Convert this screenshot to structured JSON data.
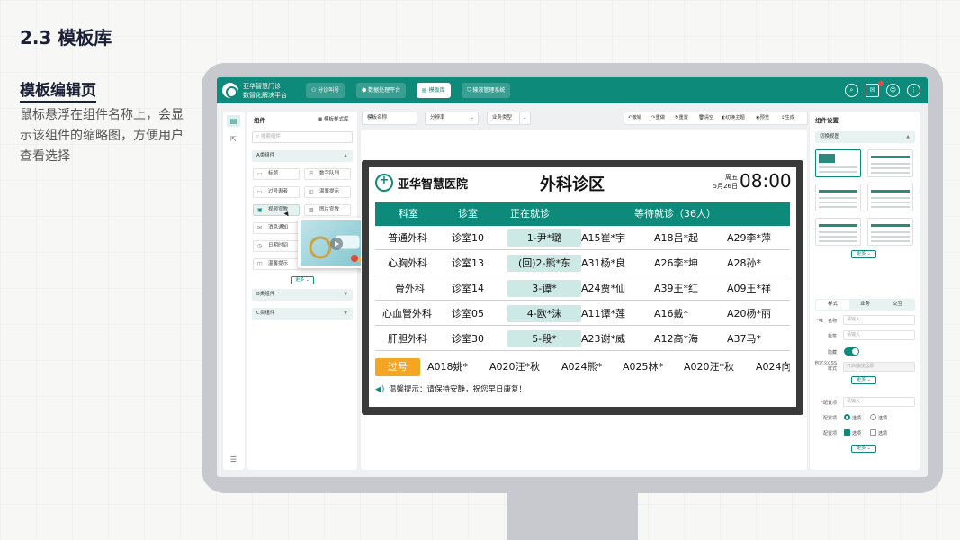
{
  "slide": {
    "title": "2.3 模板库",
    "section_heading": "模板编辑页",
    "description": "鼠标悬浮在组件名称上，会显示该组件的缩略图，方便用户查看选择"
  },
  "app": {
    "brand_line1": "亚华智慧门诊",
    "brand_line2": "数智化解决平台",
    "nav": [
      {
        "label": "分诊叫号",
        "active": false
      },
      {
        "label": "数据处理平台",
        "active": false
      },
      {
        "label": "模板库",
        "active": true
      },
      {
        "label": "输液管理系统",
        "active": false
      }
    ],
    "icons": [
      "search-icon",
      "mail-icon",
      "user-icon",
      "more-icon"
    ]
  },
  "left_panel": {
    "title": "组件",
    "lib_link": "模板样式库",
    "search_placeholder": "搜索组件",
    "group_a": "A类组件",
    "components": [
      "标题",
      "数字队列",
      "过号患者",
      "温馨提示",
      "视频宣教",
      "图片宣教",
      "消息通知",
      "日期时间",
      "温馨提示"
    ],
    "more": "更多",
    "group_b": "B类组件",
    "group_c": "C类组件"
  },
  "toolbar": {
    "template_name": "模板名称",
    "resolution": "分辨率",
    "business_type": "业务类型",
    "actions": [
      "撤销",
      "重做",
      "重置",
      "清空",
      "切换主题",
      "预览",
      "生成"
    ]
  },
  "display": {
    "hospital": "亚华智慧医院",
    "area": "外科诊区",
    "weekday": "周五",
    "date": "5月26日",
    "time": "08:00",
    "headers": [
      "科室",
      "诊室",
      "正在就诊",
      "等待就诊（36人）"
    ],
    "rows": [
      {
        "dept": "普通外科",
        "room": "诊室10",
        "current": "1-尹*璐",
        "waiting": [
          "A15崔*宇",
          "A18吕*起",
          "A29李*萍"
        ]
      },
      {
        "dept": "心胸外科",
        "room": "诊室13",
        "current": "(回)2-熊*东",
        "waiting": [
          "A31杨*良",
          "A26李*坤",
          "A28孙*"
        ]
      },
      {
        "dept": "骨外科",
        "room": "诊室14",
        "current": "3-谭*",
        "waiting": [
          "A24贾*仙",
          "A39王*红",
          "A09王*祥"
        ]
      },
      {
        "dept": "心血管外科",
        "room": "诊室05",
        "current": "4-欧*沫",
        "waiting": [
          "A11谭*莲",
          "A16戴*",
          "A20杨*丽"
        ]
      },
      {
        "dept": "肝胆外科",
        "room": "诊室30",
        "current": "5-段*",
        "waiting": [
          "A23谢*威",
          "A12高*海",
          "A37马*"
        ]
      }
    ],
    "pass_label": "过号",
    "pass_list": [
      "A018姚*",
      "A020汪*秋",
      "A024熊*",
      "A025林*",
      "A020汪*秋",
      "A024向"
    ],
    "tip": "温馨提示：请保持安静，祝您早日康复！"
  },
  "right_panel": {
    "title": "组件设置",
    "switch_view": "切换视图",
    "more": "更多",
    "tabs": [
      "样式",
      "业务",
      "交互"
    ],
    "fields": [
      {
        "label": "唯一名称",
        "placeholder": "请输入",
        "required": true
      },
      {
        "label": "标签",
        "placeholder": "请输入"
      },
      {
        "label": "隐藏"
      },
      {
        "label": "自定义CSS样式",
        "placeholder": "开启播放器源"
      }
    ],
    "config_label": "配置项",
    "config_placeholder": "请输入",
    "option_label": "选项"
  }
}
